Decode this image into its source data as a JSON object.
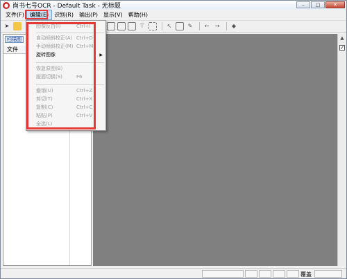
{
  "window": {
    "title": "尚书七号OCR - Default Task - 无标题"
  },
  "menubar": {
    "items": [
      "文件(F)",
      "编辑(E)",
      "识别(R)",
      "输出(P)",
      "显示(V)",
      "帮助(H)"
    ]
  },
  "edit_menu": {
    "items": [
      {
        "label": "图像反白(I)",
        "shortcut": "Ctrl+I",
        "enabled": false
      },
      {
        "label": "自动倾斜校正(A)",
        "shortcut": "Ctrl+D",
        "enabled": false
      },
      {
        "label": "手动倾斜校正(M)",
        "shortcut": "Ctrl+M",
        "enabled": false
      },
      {
        "label": "旋转图像",
        "shortcut": "",
        "enabled": true,
        "submenu": true
      },
      {
        "label": "恢复原图(B)",
        "shortcut": "",
        "enabled": false
      },
      {
        "label": "版面切换(S)",
        "shortcut": "F6",
        "enabled": false
      },
      {
        "label": "撤销(U)",
        "shortcut": "Ctrl+Z",
        "enabled": false
      },
      {
        "label": "剪切(T)",
        "shortcut": "Ctrl+X",
        "enabled": false
      },
      {
        "label": "复制(C)",
        "shortcut": "Ctrl+C",
        "enabled": false
      },
      {
        "label": "粘贴(P)",
        "shortcut": "Ctrl+V",
        "enabled": false
      },
      {
        "label": "全选(L)",
        "shortcut": "",
        "enabled": false
      }
    ]
  },
  "left_panel": {
    "tab_label": "扫描图",
    "column_header": "文件"
  },
  "statusbar": {
    "text": "覆盖"
  },
  "colors": {
    "highlight": "#e53935",
    "workspace": "#808080"
  }
}
